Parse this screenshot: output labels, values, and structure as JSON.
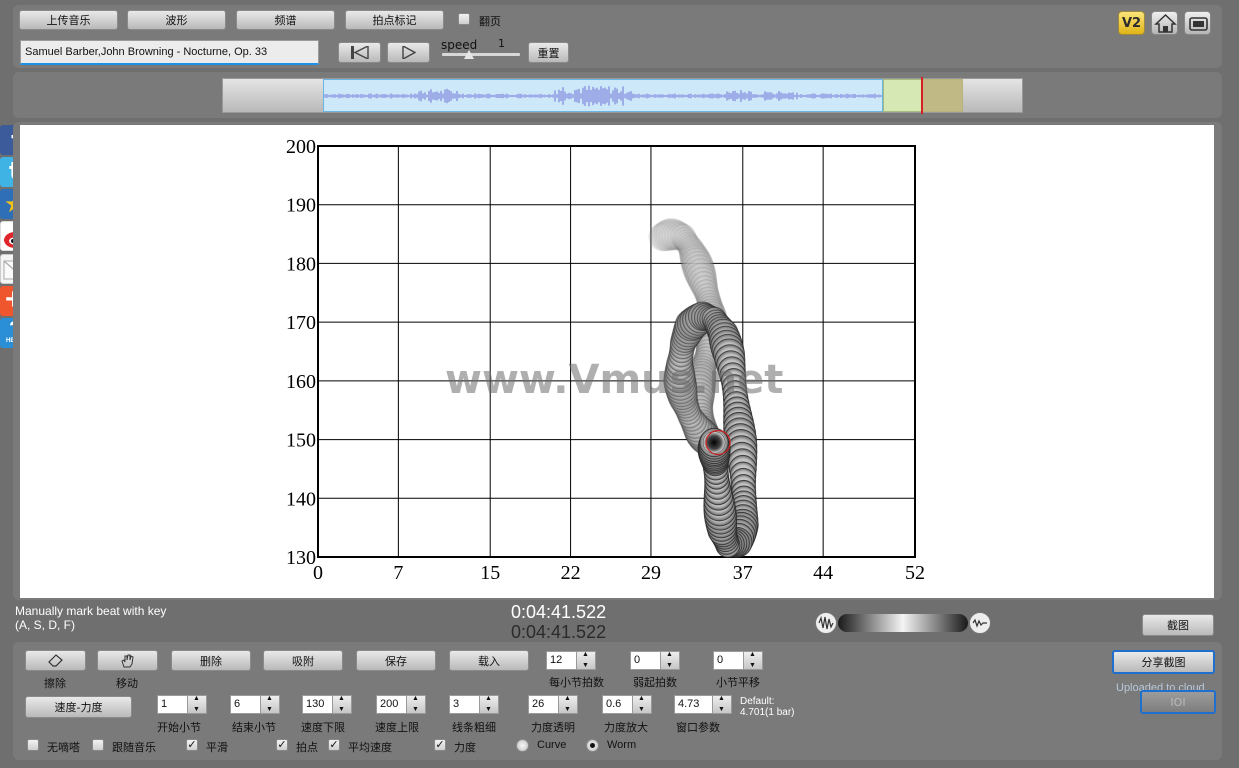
{
  "toolbar": {
    "upload_music": "上传音乐",
    "waveform": "波形",
    "spectrum": "频谱",
    "beat_mark": "拍点标记",
    "page_turn": "翻页",
    "reset": "重置",
    "speed_label": "speed",
    "speed_value": "1",
    "speed_level": 0.35,
    "track_title": "Samuel Barber,John Browning - Nocturne, Op. 33",
    "v2_badge": "V2"
  },
  "chart_data": {
    "type": "scatter",
    "xlabel": "",
    "ylabel": "",
    "xlim": [
      0,
      52
    ],
    "ylim": [
      130,
      200
    ],
    "x_ticks": [
      "0",
      "7",
      "15",
      "22",
      "29",
      "37",
      "44",
      "52"
    ],
    "y_ticks": [
      "130",
      "140",
      "150",
      "160",
      "170",
      "180",
      "190",
      "200"
    ],
    "grid": true,
    "watermark": "www.Vmus.net",
    "trail": [
      [
        30.0,
        184.5
      ],
      [
        30.8,
        185.0
      ],
      [
        31.8,
        184.5
      ],
      [
        32.5,
        182.5
      ],
      [
        33.0,
        180.0
      ],
      [
        33.5,
        177.0
      ],
      [
        34.0,
        174.0
      ],
      [
        34.3,
        171.0
      ],
      [
        34.3,
        168.0
      ],
      [
        34.0,
        165.0
      ],
      [
        33.5,
        162.0
      ],
      [
        33.2,
        159.0
      ],
      [
        33.2,
        156.0
      ],
      [
        33.5,
        153.0
      ],
      [
        33.8,
        150.0
      ],
      [
        33.2,
        151.5
      ],
      [
        32.4,
        154.0
      ],
      [
        31.8,
        157.0
      ],
      [
        31.5,
        160.0
      ],
      [
        31.5,
        163.0
      ],
      [
        31.8,
        166.5
      ],
      [
        32.5,
        169.5
      ],
      [
        33.5,
        171.0
      ],
      [
        34.5,
        170.5
      ],
      [
        35.3,
        168.0
      ],
      [
        35.8,
        164.5
      ],
      [
        36.2,
        160.0
      ],
      [
        36.5,
        155.0
      ],
      [
        36.8,
        150.0
      ],
      [
        37.0,
        145.0
      ],
      [
        37.1,
        140.0
      ],
      [
        37.0,
        135.5
      ],
      [
        36.5,
        132.5
      ],
      [
        35.7,
        132.0
      ],
      [
        35.2,
        134.5
      ],
      [
        35.0,
        138.0
      ],
      [
        34.8,
        142.0
      ],
      [
        34.6,
        146.0
      ],
      [
        34.5,
        148.0
      ],
      [
        34.5,
        149.5
      ]
    ],
    "current_point": [
      34.5,
      149.5
    ]
  },
  "status": {
    "instruction_line1": "Manually mark beat with key",
    "instruction_line2": "(A, S, D, F)",
    "time1": "0:04:41.522",
    "time2": "0:04:41.522",
    "screenshot": "截图"
  },
  "controls": {
    "erase": "擦除",
    "move": "移动",
    "delete": "删除",
    "snap": "吸附",
    "save": "保存",
    "load": "载入",
    "beats_per_bar_value": "12",
    "beats_per_bar_label": "每小节拍数",
    "pickup_value": "0",
    "pickup_label": "弱起拍数",
    "bar_offset_value": "0",
    "bar_offset_label": "小节平移",
    "share_screenshot": "分享截图",
    "uploaded": "Uploaded to cloud.",
    "ioi": "IOI",
    "mode": "速度-力度",
    "start_bar_value": "1",
    "start_bar_label": "开始小节",
    "end_bar_value": "6",
    "end_bar_label": "结束小节",
    "tempo_min_value": "130",
    "tempo_min_label": "速度下限",
    "tempo_max_value": "200",
    "tempo_max_label": "速度上限",
    "line_width_value": "3",
    "line_width_label": "线条粗细",
    "dyn_alpha_value": "26",
    "dyn_alpha_label": "力度透明",
    "dyn_scale_value": "0.6",
    "dyn_scale_label": "力度放大",
    "window_value": "4.73",
    "window_label": "窗口参数",
    "default_line1": "Default:",
    "default_line2": "4.701(1 bar)",
    "metronome": "无嘀嗒",
    "follow_music": "跟随音乐",
    "smooth": "平滑",
    "beats": "拍点",
    "avg_tempo": "平均速度",
    "dynamics": "力度",
    "curve": "Curve",
    "worm": "Worm"
  }
}
